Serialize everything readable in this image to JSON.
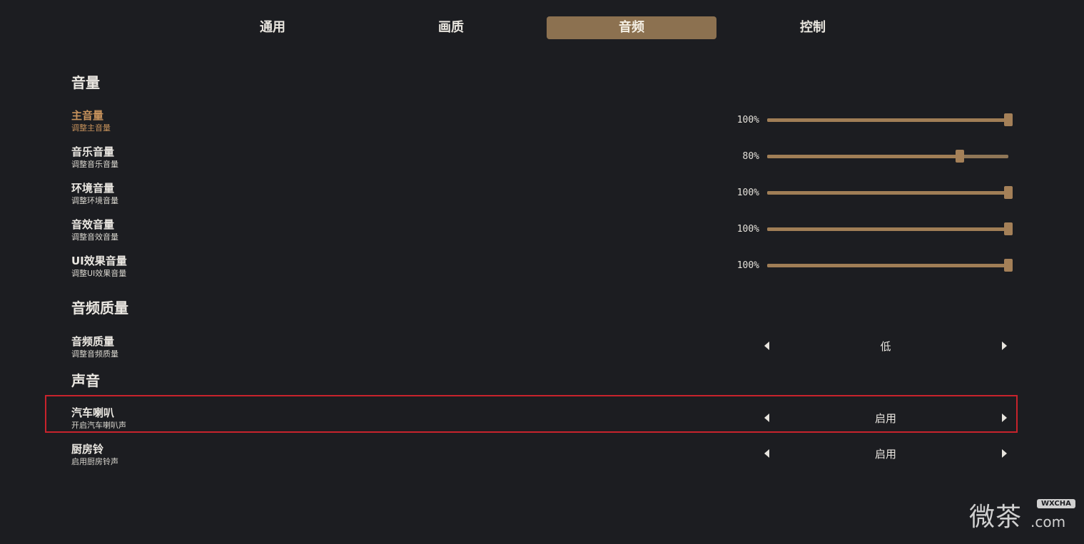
{
  "tabs": [
    {
      "label": "通用",
      "active": false
    },
    {
      "label": "画质",
      "active": false
    },
    {
      "label": "音频",
      "active": true
    },
    {
      "label": "控制",
      "active": false
    }
  ],
  "sections": {
    "volume": "音量",
    "quality": "音频质量",
    "sound": "声音"
  },
  "sliders": [
    {
      "title": "主音量",
      "subtitle": "调整主音量",
      "value_label": "100%",
      "value": 100
    },
    {
      "title": "音乐音量",
      "subtitle": "调整音乐音量",
      "value_label": "80%",
      "value": 80
    },
    {
      "title": "环境音量",
      "subtitle": "调整环境音量",
      "value_label": "100%",
      "value": 100
    },
    {
      "title": "音效音量",
      "subtitle": "调整音效音量",
      "value_label": "100%",
      "value": 100
    },
    {
      "title": "UI效果音量",
      "subtitle": "调整UI效果音量",
      "value_label": "100%",
      "value": 100
    }
  ],
  "selectors": [
    {
      "title": "音频质量",
      "subtitle": "调整音频质量",
      "value": "低"
    },
    {
      "title": "汽车喇叭",
      "subtitle": "开启汽车喇叭声",
      "value": "启用"
    },
    {
      "title": "厨房铃",
      "subtitle": "启用厨房铃声",
      "value": "启用"
    }
  ],
  "watermark": {
    "text": "微茶",
    "badge": "WXCHA",
    "suffix": ".com"
  },
  "colors": {
    "accent": "#8c7150",
    "active_text": "#c8935c",
    "highlight_border": "#c8232c",
    "background": "#1c1d21"
  },
  "icons": {
    "left": "triangle-left-icon",
    "right": "triangle-right-icon"
  }
}
